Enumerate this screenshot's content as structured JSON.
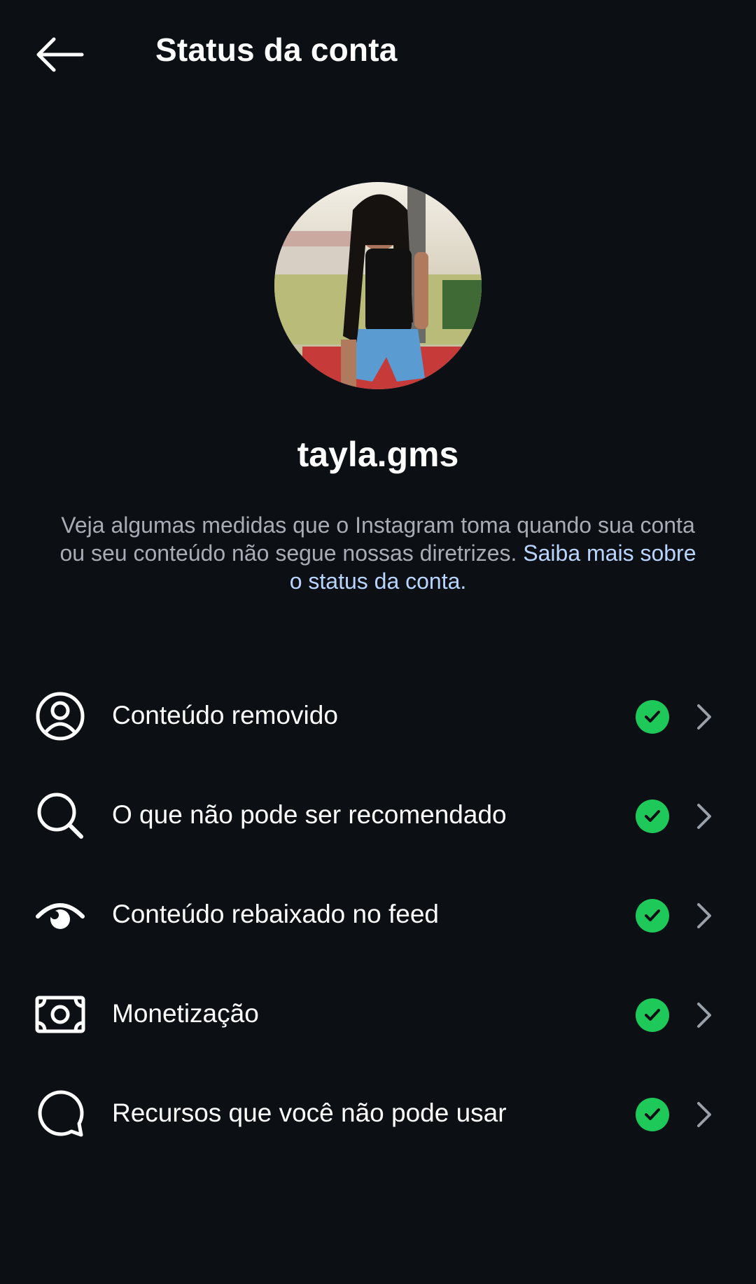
{
  "header": {
    "title": "Status da conta",
    "back_icon": "arrow-left-icon"
  },
  "profile": {
    "username": "tayla.gms"
  },
  "description": {
    "text": "Veja algumas medidas que o Instagram toma quando sua conta ou seu conteúdo não segue nossas diretrizes. ",
    "link_text": "Saiba mais sobre o status da conta."
  },
  "items": [
    {
      "label": "Conteúdo removido",
      "icon": "user-circle-icon",
      "status": "ok"
    },
    {
      "label": "O que não pode ser recomendado",
      "icon": "search-icon",
      "status": "ok"
    },
    {
      "label": "Conteúdo rebaixado no feed",
      "icon": "eye-downrank-icon",
      "status": "ok"
    },
    {
      "label": "Monetização",
      "icon": "money-icon",
      "status": "ok"
    },
    {
      "label": "Recursos que você não pode usar",
      "icon": "chat-bubble-icon",
      "status": "ok"
    }
  ],
  "colors": {
    "background": "#0c0f14",
    "status_ok": "#1ec95a",
    "link": "#b9d4ff",
    "muted_text": "#a8adb5"
  }
}
